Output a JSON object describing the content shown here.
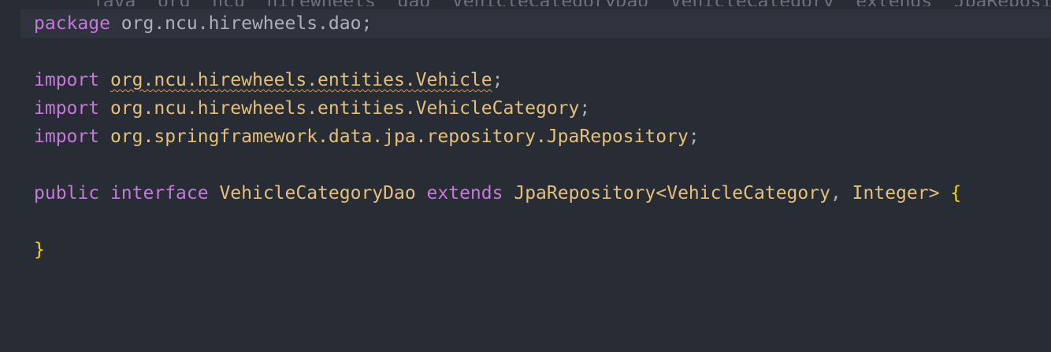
{
  "top_strip_text": "   java  org  ncu  hirewheels  dao  VehicleCategoryDao  VehicleCategory  extends  JpaRepository  Integer",
  "lines": {
    "package": {
      "keyword": "package",
      "name": "org.ncu.hirewheels.dao",
      "terminator": ";"
    },
    "import1": {
      "keyword": "import",
      "name": "org.ncu.hirewheels.entities.Vehicle",
      "terminator": ";",
      "warning": true
    },
    "import2": {
      "keyword": "import",
      "name": "org.ncu.hirewheels.entities.VehicleCategory",
      "terminator": ";"
    },
    "import3": {
      "keyword": "import",
      "name": "org.springframework.data.jpa.repository.JpaRepository",
      "terminator": ";"
    },
    "decl": {
      "modifier": "public",
      "kind": "interface",
      "name": "VehicleCategoryDao",
      "extends_kw": "extends",
      "super_type": "JpaRepository",
      "lt": "<",
      "type_arg1": "VehicleCategory",
      "comma": ",",
      "type_arg2": "Integer",
      "gt": ">",
      "open_brace": "{"
    },
    "close": {
      "close_brace": "}"
    }
  },
  "colors": {
    "background": "#282c34",
    "current_line": "#2f333d",
    "keyword": "#c678dd",
    "type": "#e5c07b",
    "plain": "#abb2bf",
    "brace": "#ffd700",
    "warning_underline": "#d19a66"
  }
}
